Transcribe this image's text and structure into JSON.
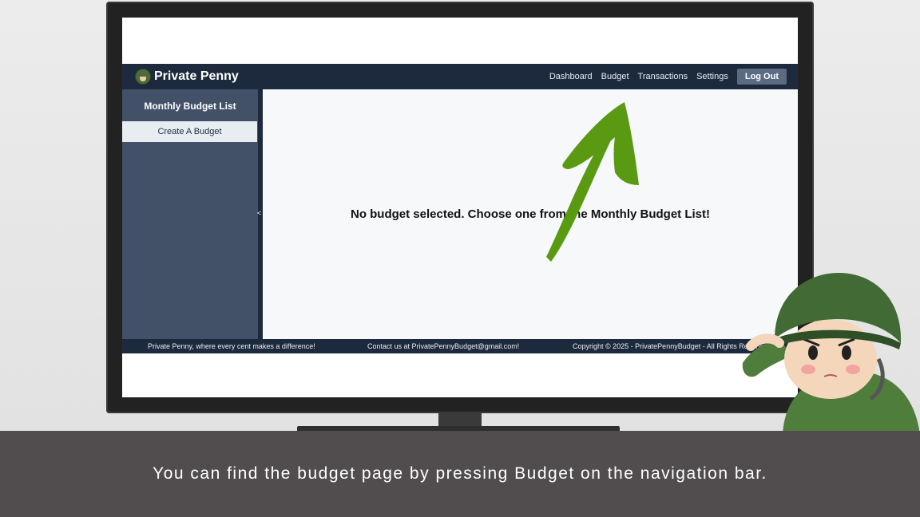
{
  "app": {
    "brand_name": "Private Penny",
    "nav": {
      "dashboard": "Dashboard",
      "budget": "Budget",
      "transactions": "Transactions",
      "settings": "Settings",
      "logout": "Log Out"
    },
    "sidebar": {
      "title": "Monthly Budget List",
      "items": [
        {
          "label": "Create A Budget"
        }
      ],
      "collapse_glyph": "<"
    },
    "main": {
      "message": "No budget selected. Choose one from the Monthly Budget List!"
    },
    "footer": {
      "tagline": "Private Penny, where every cent makes a difference!",
      "contact": "Contact us at PrivatePennyBudget@gmail.com!",
      "copyright": "Copyright © 2025 - PrivatePennyBudget - All Rights Reserved"
    }
  },
  "caption": "You can find the budget page by pressing Budget on the navigation bar.",
  "colors": {
    "navbar": "#1d2a3d",
    "sidebar": "#435168",
    "arrow": "#5a9a12",
    "caption_bar": "#514d4e"
  },
  "icons": {
    "logo": "soldier-logo-icon",
    "arrow": "green-arrow-icon",
    "mascot": "saluting-soldier-icon"
  }
}
